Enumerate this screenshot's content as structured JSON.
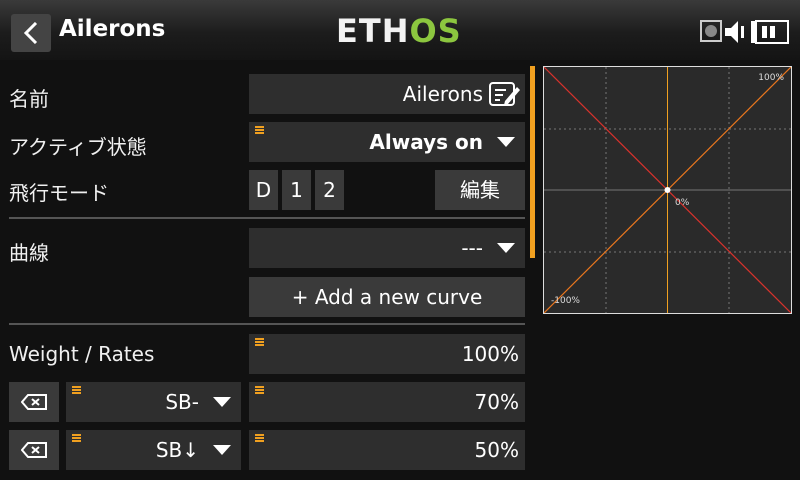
{
  "header": {
    "title": "Ailerons",
    "logo_part1": "ETH",
    "logo_part2": "OS",
    "logo_colors": {
      "white": "#f2f2f2",
      "green": "#8cc63f"
    },
    "icons": [
      "back-arrow-icon",
      "record-icon",
      "speaker-icon",
      "battery-icon"
    ]
  },
  "rows": {
    "name": {
      "label": "名前",
      "value": "Ailerons",
      "icon": "edit-icon"
    },
    "active": {
      "label": "アクティブ状態",
      "value": "Always on"
    },
    "flight_mode": {
      "label": "飛行モード",
      "modes": [
        "D",
        "1",
        "2"
      ],
      "edit_label": "編集"
    },
    "curve": {
      "label": "曲線",
      "value": "---",
      "add_label": "+ Add a new curve"
    },
    "weight": {
      "label": "Weight / Rates",
      "value": "100%"
    },
    "rate1": {
      "switch": "SB-",
      "value": "70%"
    },
    "rate2": {
      "switch": "SB↓",
      "value": "50%"
    }
  },
  "graph": {
    "top_right_label": "100%",
    "center_label": "0%",
    "bottom_left_label": "-100%",
    "accent_color": "#f0a020",
    "line_colors": {
      "orange": "#e8761e",
      "red": "#d8322c"
    }
  }
}
